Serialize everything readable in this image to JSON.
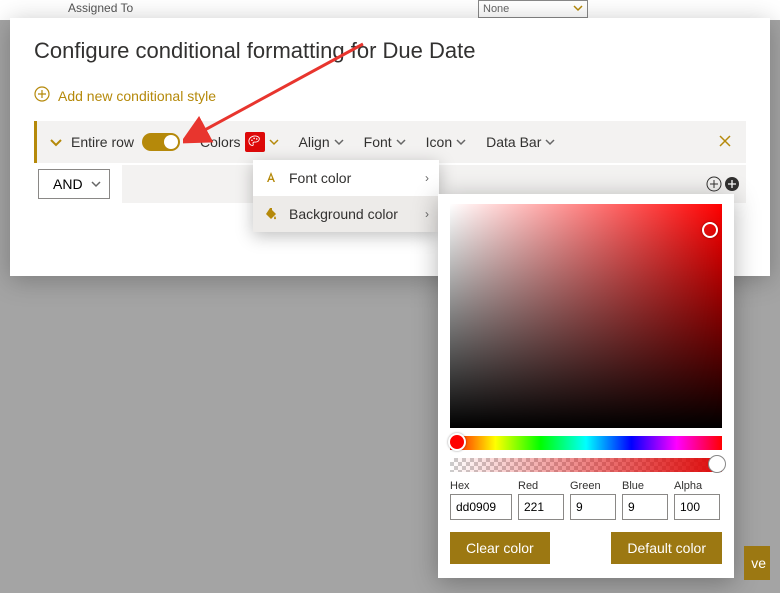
{
  "bg": {
    "field": "Assigned To",
    "none": "None"
  },
  "dialog": {
    "title": "Configure conditional formatting for Due Date",
    "add_link": "Add new conditional style"
  },
  "rule": {
    "scope": "Entire row",
    "colors": "Colors",
    "align": "Align",
    "font": "Font",
    "icon": "Icon",
    "databar": "Data Bar"
  },
  "logic": {
    "and": "AND"
  },
  "colors_flyout": {
    "font": "Font color",
    "background": "Background color"
  },
  "picker": {
    "labels": {
      "hex": "Hex",
      "red": "Red",
      "green": "Green",
      "blue": "Blue",
      "alpha": "Alpha"
    },
    "values": {
      "hex": "dd0909",
      "red": "221",
      "green": "9",
      "blue": "9",
      "alpha": "100"
    },
    "clear": "Clear color",
    "default": "Default color"
  },
  "save_stub": "ve"
}
